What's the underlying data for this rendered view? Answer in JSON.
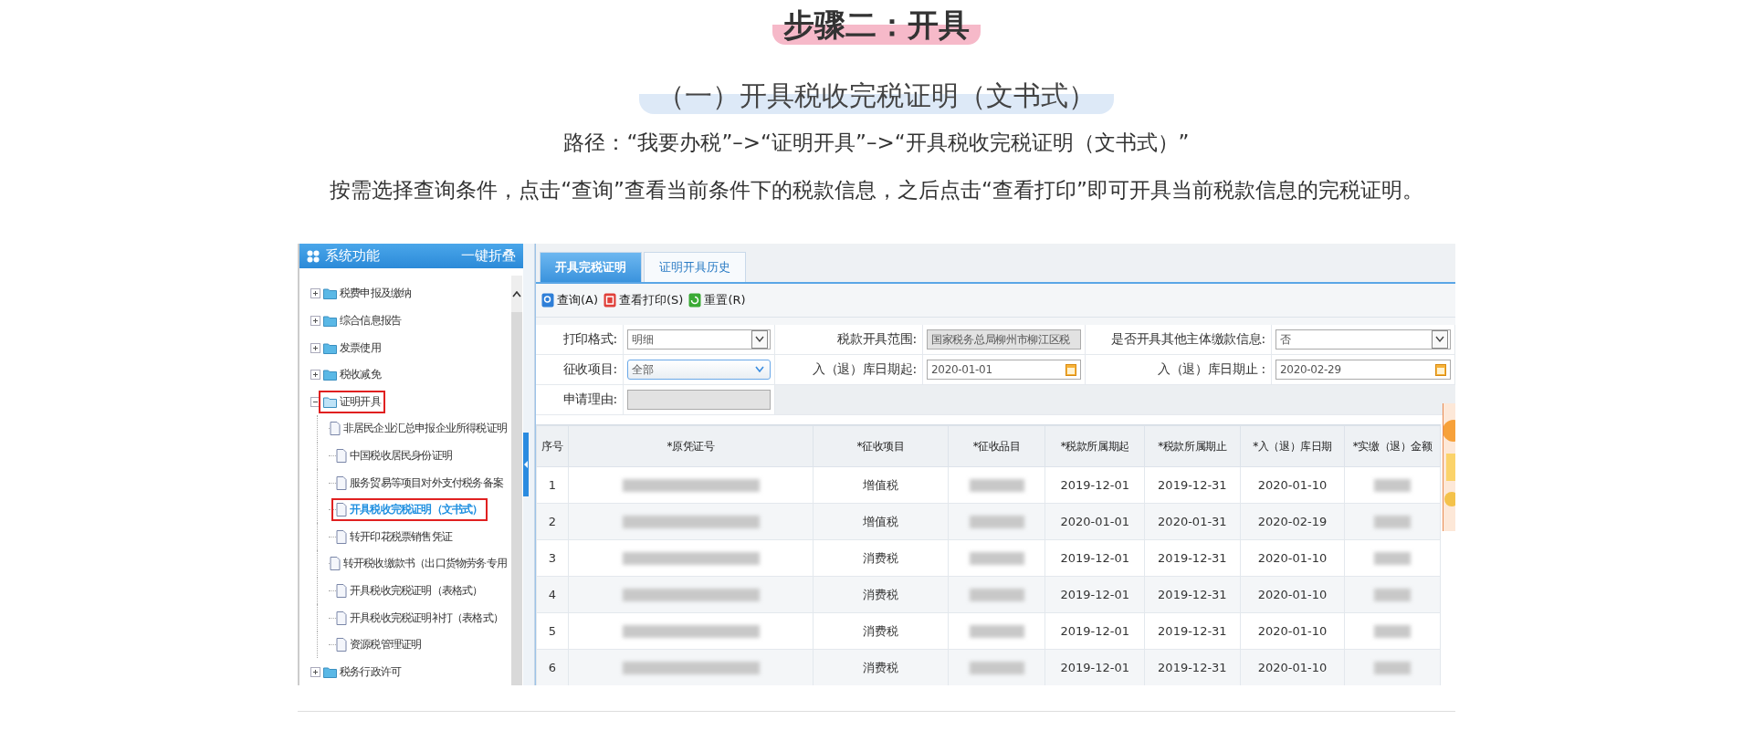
{
  "heading": "步骤二：开具",
  "subheading": "（一）开具税收完税证明（文书式）",
  "path_line": "路径：“我要办税”–>“证明开具”–>“开具税收完税证明（文书式）”",
  "instruction": "按需选择查询条件，点击“查询”查看当前条件下的税款信息，之后点击“查看打印”即可开具当前税款信息的完税证明。",
  "screenshot": {
    "sidebar": {
      "title": "系统功能",
      "collapse_button": "一键折叠",
      "tree": [
        {
          "label": "税费申报及缴纳",
          "expanded": false,
          "highlighted": false
        },
        {
          "label": "综合信息报告",
          "expanded": false,
          "highlighted": false
        },
        {
          "label": "发票使用",
          "expanded": false,
          "highlighted": false
        },
        {
          "label": "税收减免",
          "expanded": false,
          "highlighted": false
        },
        {
          "label": "证明开具",
          "expanded": true,
          "highlighted": true,
          "children": [
            {
              "label": "非居民企业汇总申报企业所得税证明",
              "selected": false,
              "highlighted": false
            },
            {
              "label": "中国税收居民身份证明",
              "selected": false,
              "highlighted": false
            },
            {
              "label": "服务贸易等项目对外支付税务备案",
              "selected": false,
              "highlighted": false
            },
            {
              "label": "开具税收完税证明（文书式）",
              "selected": true,
              "highlighted": true
            },
            {
              "label": "转开印花税票销售凭证",
              "selected": false,
              "highlighted": false
            },
            {
              "label": "转开税收缴款书（出口货物劳务专用",
              "selected": false,
              "highlighted": false
            },
            {
              "label": "开具税收完税证明（表格式）",
              "selected": false,
              "highlighted": false
            },
            {
              "label": "开具税收完税证明补打（表格式）",
              "selected": false,
              "highlighted": false
            },
            {
              "label": "资源税管理证明",
              "selected": false,
              "highlighted": false
            }
          ]
        },
        {
          "label": "税务行政许可",
          "expanded": false,
          "highlighted": false
        }
      ]
    },
    "tabs": [
      {
        "label": "开具完税证明",
        "selected": true
      },
      {
        "label": "证明开具历史",
        "selected": false
      }
    ],
    "toolbar": [
      {
        "label": "查询(A)",
        "kind": "search"
      },
      {
        "label": "查看打印(S)",
        "kind": "print"
      },
      {
        "label": "重置(R)",
        "kind": "reset"
      }
    ],
    "form": [
      [
        {
          "label": "打印格式:",
          "kind": "select",
          "value": "明细"
        },
        {
          "label": "税款开具范围:",
          "kind": "readonly",
          "value": "国家税务总局柳州市柳江区税"
        },
        {
          "label": "是否开具其他主体缴款信息:",
          "kind": "select",
          "value": "否"
        }
      ],
      [
        {
          "label": "征收项目:",
          "kind": "dropdown",
          "value": "全部"
        },
        {
          "label": "入（退）库日期起:",
          "kind": "date",
          "value": "2020-01-01"
        },
        {
          "label": "入（退）库日期止 :",
          "kind": "date",
          "value": "2020-02-29"
        }
      ],
      [
        {
          "label": "申请理由:",
          "kind": "readonly"
        }
      ]
    ],
    "table": {
      "columns": [
        "序号",
        "*原凭证号",
        "*征收项目",
        "*征收品目",
        "*税款所属期起",
        "*税款所属期止",
        "*入（退）库日期",
        "*实缴（退）金额"
      ],
      "rows": [
        [
          {
            "kind": "text",
            "text": "1"
          },
          {
            "kind": "blurred"
          },
          {
            "kind": "text",
            "text": "增值税"
          },
          {
            "kind": "blurred"
          },
          {
            "kind": "text",
            "text": "2019-12-01"
          },
          {
            "kind": "text",
            "text": "2019-12-31"
          },
          {
            "kind": "text",
            "text": "2020-01-10"
          },
          {
            "kind": "blurred"
          }
        ],
        [
          {
            "kind": "text",
            "text": "2"
          },
          {
            "kind": "blurred"
          },
          {
            "kind": "text",
            "text": "增值税"
          },
          {
            "kind": "blurred"
          },
          {
            "kind": "text",
            "text": "2020-01-01"
          },
          {
            "kind": "text",
            "text": "2020-01-31"
          },
          {
            "kind": "text",
            "text": "2020-02-19"
          },
          {
            "kind": "blurred"
          }
        ],
        [
          {
            "kind": "text",
            "text": "3"
          },
          {
            "kind": "blurred"
          },
          {
            "kind": "text",
            "text": "消费税"
          },
          {
            "kind": "blurred"
          },
          {
            "kind": "text",
            "text": "2019-12-01"
          },
          {
            "kind": "text",
            "text": "2019-12-31"
          },
          {
            "kind": "text",
            "text": "2020-01-10"
          },
          {
            "kind": "blurred"
          }
        ],
        [
          {
            "kind": "text",
            "text": "4"
          },
          {
            "kind": "blurred"
          },
          {
            "kind": "text",
            "text": "消费税"
          },
          {
            "kind": "blurred"
          },
          {
            "kind": "text",
            "text": "2019-12-01"
          },
          {
            "kind": "text",
            "text": "2019-12-31"
          },
          {
            "kind": "text",
            "text": "2020-01-10"
          },
          {
            "kind": "blurred"
          }
        ],
        [
          {
            "kind": "text",
            "text": "5"
          },
          {
            "kind": "blurred"
          },
          {
            "kind": "text",
            "text": "消费税"
          },
          {
            "kind": "blurred"
          },
          {
            "kind": "text",
            "text": "2019-12-01"
          },
          {
            "kind": "text",
            "text": "2019-12-31"
          },
          {
            "kind": "text",
            "text": "2020-01-10"
          },
          {
            "kind": "blurred"
          }
        ],
        [
          {
            "kind": "text",
            "text": "6"
          },
          {
            "kind": "blurred"
          },
          {
            "kind": "text",
            "text": "消费税"
          },
          {
            "kind": "blurred"
          },
          {
            "kind": "text",
            "text": "2019-12-01"
          },
          {
            "kind": "text",
            "text": "2019-12-31"
          },
          {
            "kind": "text",
            "text": "2020-01-10"
          },
          {
            "kind": "blurred"
          }
        ]
      ]
    },
    "side_picture": {
      "kind": "picture"
    }
  }
}
